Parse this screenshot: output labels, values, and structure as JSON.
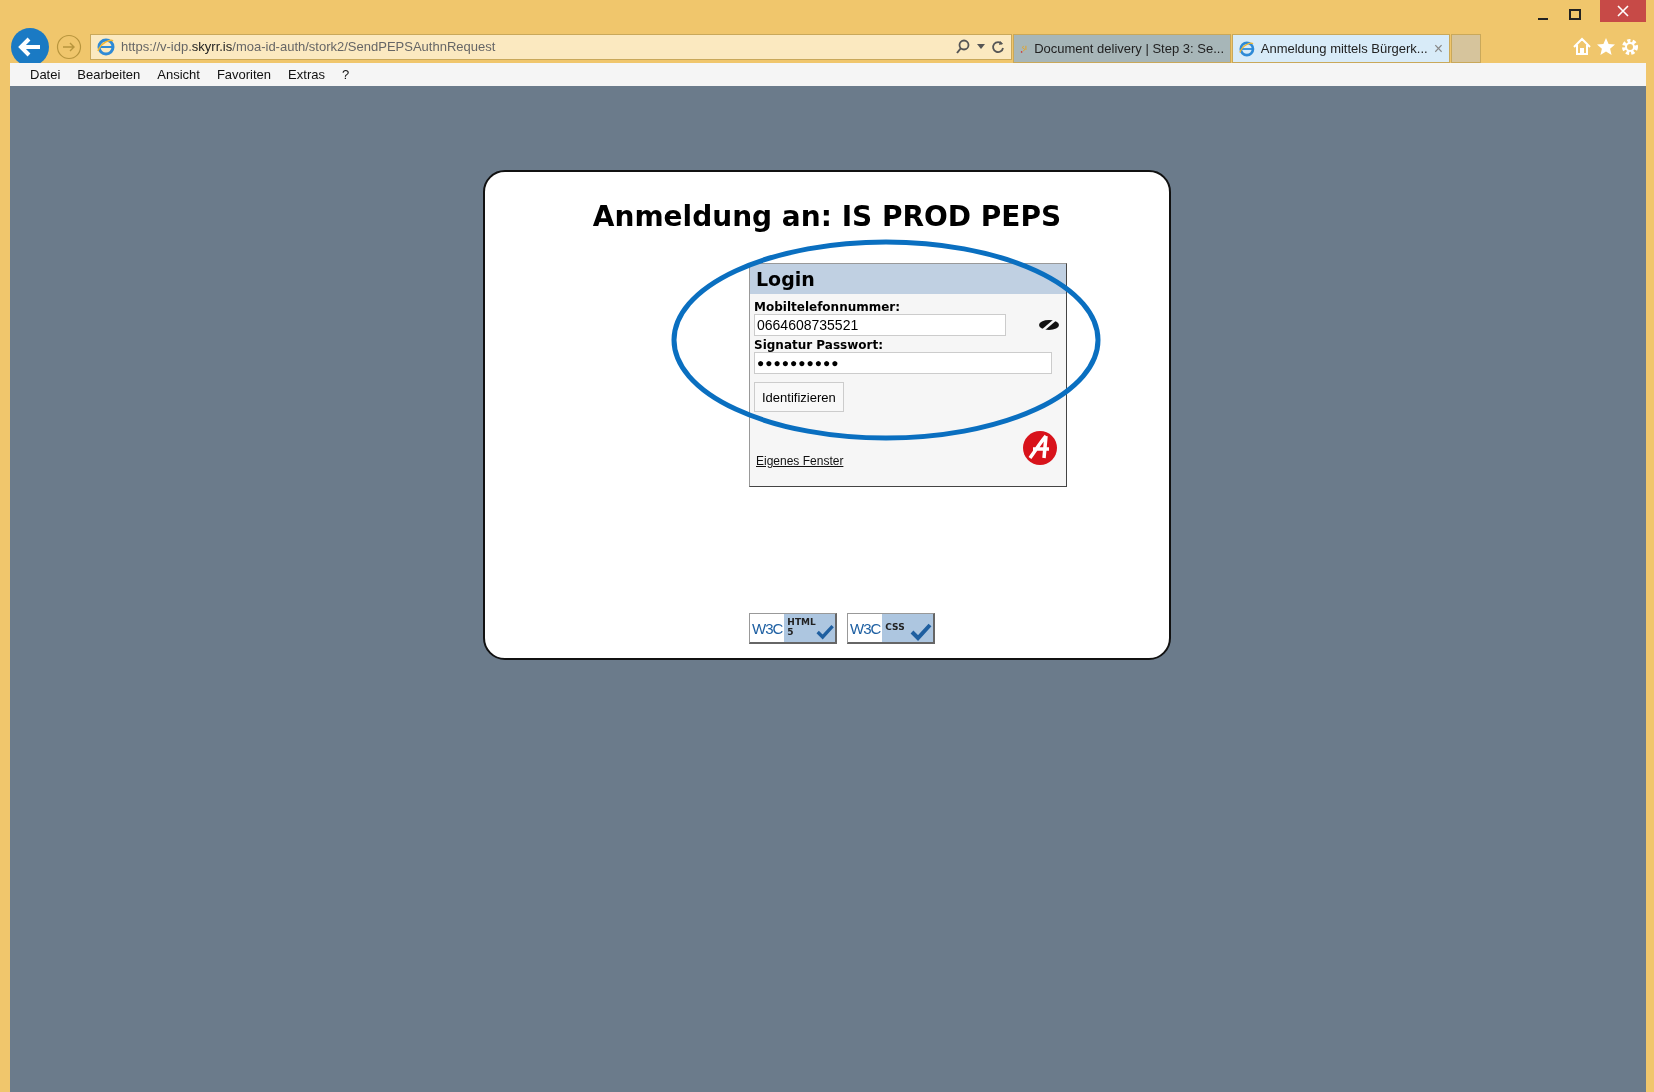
{
  "address_bar": {
    "url_prefix": "https://v-idp.",
    "url_domain": "skyrr.is",
    "url_path": "/moa-id-auth/stork2/SendPEPSAuthnRequest"
  },
  "tabs": [
    {
      "title": "Document delivery | Step 3: Se...",
      "selected": false,
      "kind": "site"
    },
    {
      "title": "Anmeldung mittels Bürgerk...",
      "selected": true,
      "kind": "ie"
    }
  ],
  "close_tab": "×",
  "menu": [
    "Datei",
    "Bearbeiten",
    "Ansicht",
    "Favoriten",
    "Extras",
    "?"
  ],
  "page": {
    "title": "Anmeldung an: IS PROD PEPS",
    "login": {
      "heading": "Login",
      "phone_label": "Mobiltelefonnummer:",
      "phone_value": "0664608735521",
      "password_label": "Signatur Passwort:",
      "password_value": "●●●●●●●●●●",
      "button": "Identifizieren",
      "link": "Eigenes Fenster"
    },
    "badges": [
      {
        "logo": "W3C",
        "label": "HTML",
        "sub": "5"
      },
      {
        "logo": "W3C",
        "label": "CSS"
      }
    ]
  }
}
